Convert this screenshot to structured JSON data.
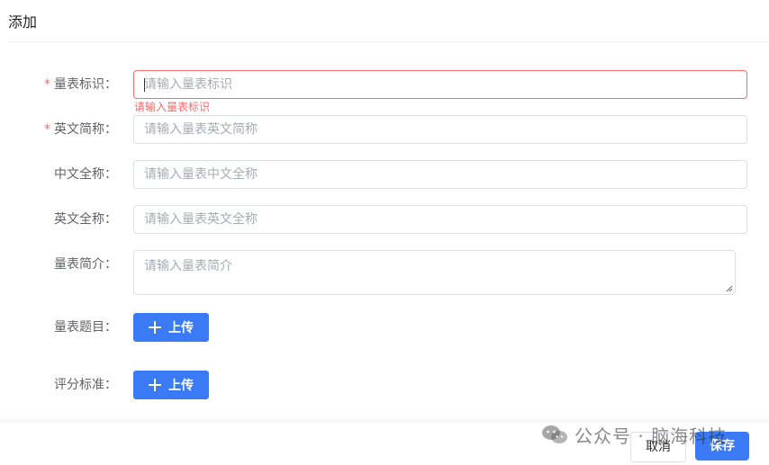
{
  "dialog": {
    "title": "添加"
  },
  "form": {
    "scale_id": {
      "label": "量表标识：",
      "required": true,
      "placeholder": "请输入量表标识",
      "error": "请输入量表标识"
    },
    "en_abbr": {
      "label": "英文简称：",
      "required": true,
      "placeholder": "请输入量表英文简称"
    },
    "cn_full": {
      "label": "中文全称：",
      "required": false,
      "placeholder": "请输入量表中文全称"
    },
    "en_full": {
      "label": "英文全称：",
      "required": false,
      "placeholder": "请输入量表英文全称"
    },
    "intro": {
      "label": "量表简介：",
      "required": false,
      "placeholder": "请输入量表简介"
    },
    "questions": {
      "label": "量表题目：",
      "button": "上传"
    },
    "scoring": {
      "label": "评分标准：",
      "button": "上传"
    }
  },
  "footer": {
    "cancel": "取消",
    "save": "保存"
  },
  "watermark": {
    "text": "公众号 · 脑海科技"
  },
  "colors": {
    "primary": "#3a7af5",
    "error": "#f56c6c",
    "border": "#dcdfe6",
    "placeholder": "#a8abb2"
  },
  "icons": {
    "upload_plus": "plus-icon",
    "watermark": "wechat-icon",
    "required": "asterisk"
  }
}
